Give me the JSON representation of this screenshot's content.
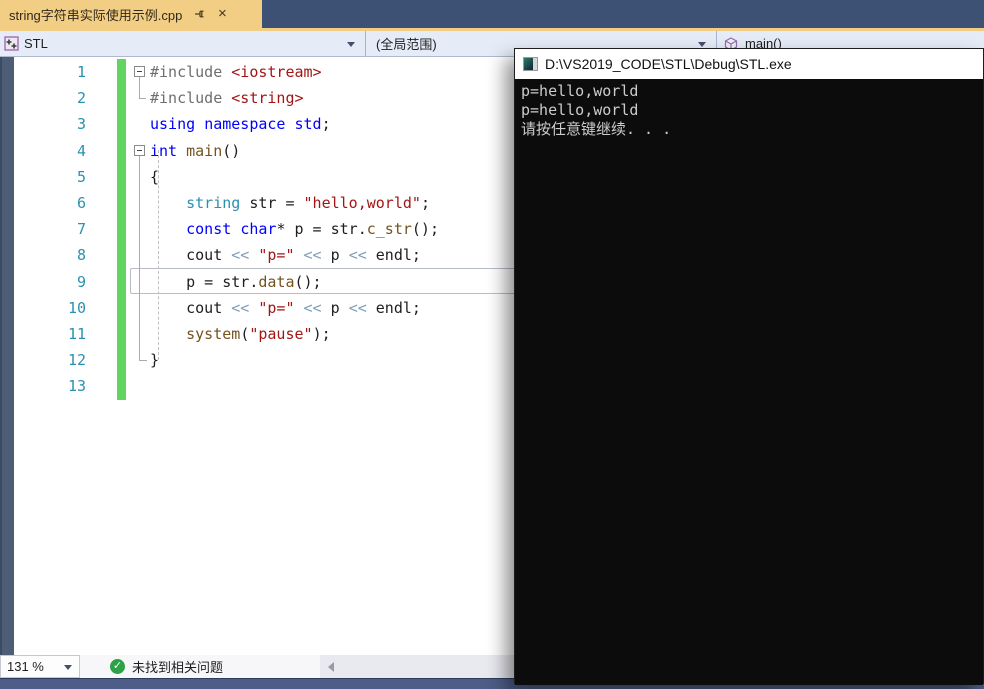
{
  "tab": {
    "title": "string字符串实际使用示例.cpp",
    "close_glyph": "×"
  },
  "navbar": {
    "project": "STL",
    "scope": "(全局范围)",
    "member": "main()"
  },
  "editor": {
    "current_line": 9,
    "lines": [
      {
        "num": "1",
        "tokens": [
          {
            "t": "#include",
            "c": "pp"
          },
          {
            "t": " ",
            "c": "pl"
          },
          {
            "t": "<iostream>",
            "c": "inc"
          }
        ]
      },
      {
        "num": "2",
        "tokens": [
          {
            "t": "#include",
            "c": "pp"
          },
          {
            "t": " ",
            "c": "pl"
          },
          {
            "t": "<string>",
            "c": "inc"
          }
        ]
      },
      {
        "num": "3",
        "tokens": [
          {
            "t": "using",
            "c": "kw"
          },
          {
            "t": " ",
            "c": "pl"
          },
          {
            "t": "namespace",
            "c": "kw"
          },
          {
            "t": " ",
            "c": "pl"
          },
          {
            "t": "std",
            "c": "kw"
          },
          {
            "t": ";",
            "c": "pl"
          }
        ]
      },
      {
        "num": "4",
        "tokens": [
          {
            "t": "int",
            "c": "kw"
          },
          {
            "t": " ",
            "c": "pl"
          },
          {
            "t": "main",
            "c": "fn"
          },
          {
            "t": "()",
            "c": "pl"
          }
        ]
      },
      {
        "num": "5",
        "tokens": [
          {
            "t": "{",
            "c": "pl"
          }
        ]
      },
      {
        "num": "6",
        "tokens": [
          {
            "t": "    ",
            "c": "pl"
          },
          {
            "t": "string",
            "c": "type"
          },
          {
            "t": " str = ",
            "c": "pl"
          },
          {
            "t": "\"hello,world\"",
            "c": "str"
          },
          {
            "t": ";",
            "c": "pl"
          }
        ]
      },
      {
        "num": "7",
        "tokens": [
          {
            "t": "    ",
            "c": "pl"
          },
          {
            "t": "const",
            "c": "kw"
          },
          {
            "t": " ",
            "c": "pl"
          },
          {
            "t": "char",
            "c": "kw"
          },
          {
            "t": "* p = str.",
            "c": "pl"
          },
          {
            "t": "c_str",
            "c": "fn"
          },
          {
            "t": "();",
            "c": "pl"
          }
        ]
      },
      {
        "num": "8",
        "tokens": [
          {
            "t": "    cout ",
            "c": "pl"
          },
          {
            "t": "<<",
            "c": "op"
          },
          {
            "t": " ",
            "c": "pl"
          },
          {
            "t": "\"p=\"",
            "c": "str"
          },
          {
            "t": " ",
            "c": "pl"
          },
          {
            "t": "<<",
            "c": "op"
          },
          {
            "t": " p ",
            "c": "pl"
          },
          {
            "t": "<<",
            "c": "op"
          },
          {
            "t": " endl;",
            "c": "pl"
          }
        ]
      },
      {
        "num": "9",
        "tokens": [
          {
            "t": "    p = str.",
            "c": "pl"
          },
          {
            "t": "data",
            "c": "fn"
          },
          {
            "t": "();",
            "c": "pl"
          }
        ]
      },
      {
        "num": "10",
        "tokens": [
          {
            "t": "    cout ",
            "c": "pl"
          },
          {
            "t": "<<",
            "c": "op"
          },
          {
            "t": " ",
            "c": "pl"
          },
          {
            "t": "\"p=\"",
            "c": "str"
          },
          {
            "t": " ",
            "c": "pl"
          },
          {
            "t": "<<",
            "c": "op"
          },
          {
            "t": " p ",
            "c": "pl"
          },
          {
            "t": "<<",
            "c": "op"
          },
          {
            "t": " endl;",
            "c": "pl"
          }
        ]
      },
      {
        "num": "11",
        "tokens": [
          {
            "t": "    ",
            "c": "pl"
          },
          {
            "t": "system",
            "c": "fn"
          },
          {
            "t": "(",
            "c": "pl"
          },
          {
            "t": "\"pause\"",
            "c": "str"
          },
          {
            "t": ");",
            "c": "pl"
          }
        ]
      },
      {
        "num": "12",
        "tokens": [
          {
            "t": "}",
            "c": "pl"
          }
        ]
      },
      {
        "num": "13",
        "tokens": []
      }
    ]
  },
  "console": {
    "title": "D:\\VS2019_CODE\\STL\\Debug\\STL.exe",
    "lines": [
      "p=hello,world",
      "p=hello,world",
      "请按任意键继续. . ."
    ]
  },
  "statusbar": {
    "zoom": "131 %",
    "health": "未找到相关问题"
  },
  "icons": {
    "tab_pin": "pushpin-icon",
    "tab_close": "close-icon",
    "project": "cpp-project-icon",
    "member": "method-cube-icon",
    "console": "cmd-window-icon",
    "health": "check-circle-icon"
  },
  "colors": {
    "tab_active": "#F2CD84",
    "tabstrip_bg": "#3C5174",
    "navbar_bg": "#E6ECF7",
    "indicator_margin": "#4E5D76",
    "change_bar_green": "#61D561",
    "line_number": "#2B91AF",
    "keyword": "#0000FF",
    "type_name": "#2B91AF",
    "function_name": "#74531F",
    "string_literal": "#A31515",
    "preprocessor": "#6E6E6E",
    "operator": "#7F9DB9",
    "console_bg": "#0C0C0C",
    "console_text": "#CCCCCC",
    "status_bar": "#4E5D87",
    "health_green": "#2DA146"
  }
}
